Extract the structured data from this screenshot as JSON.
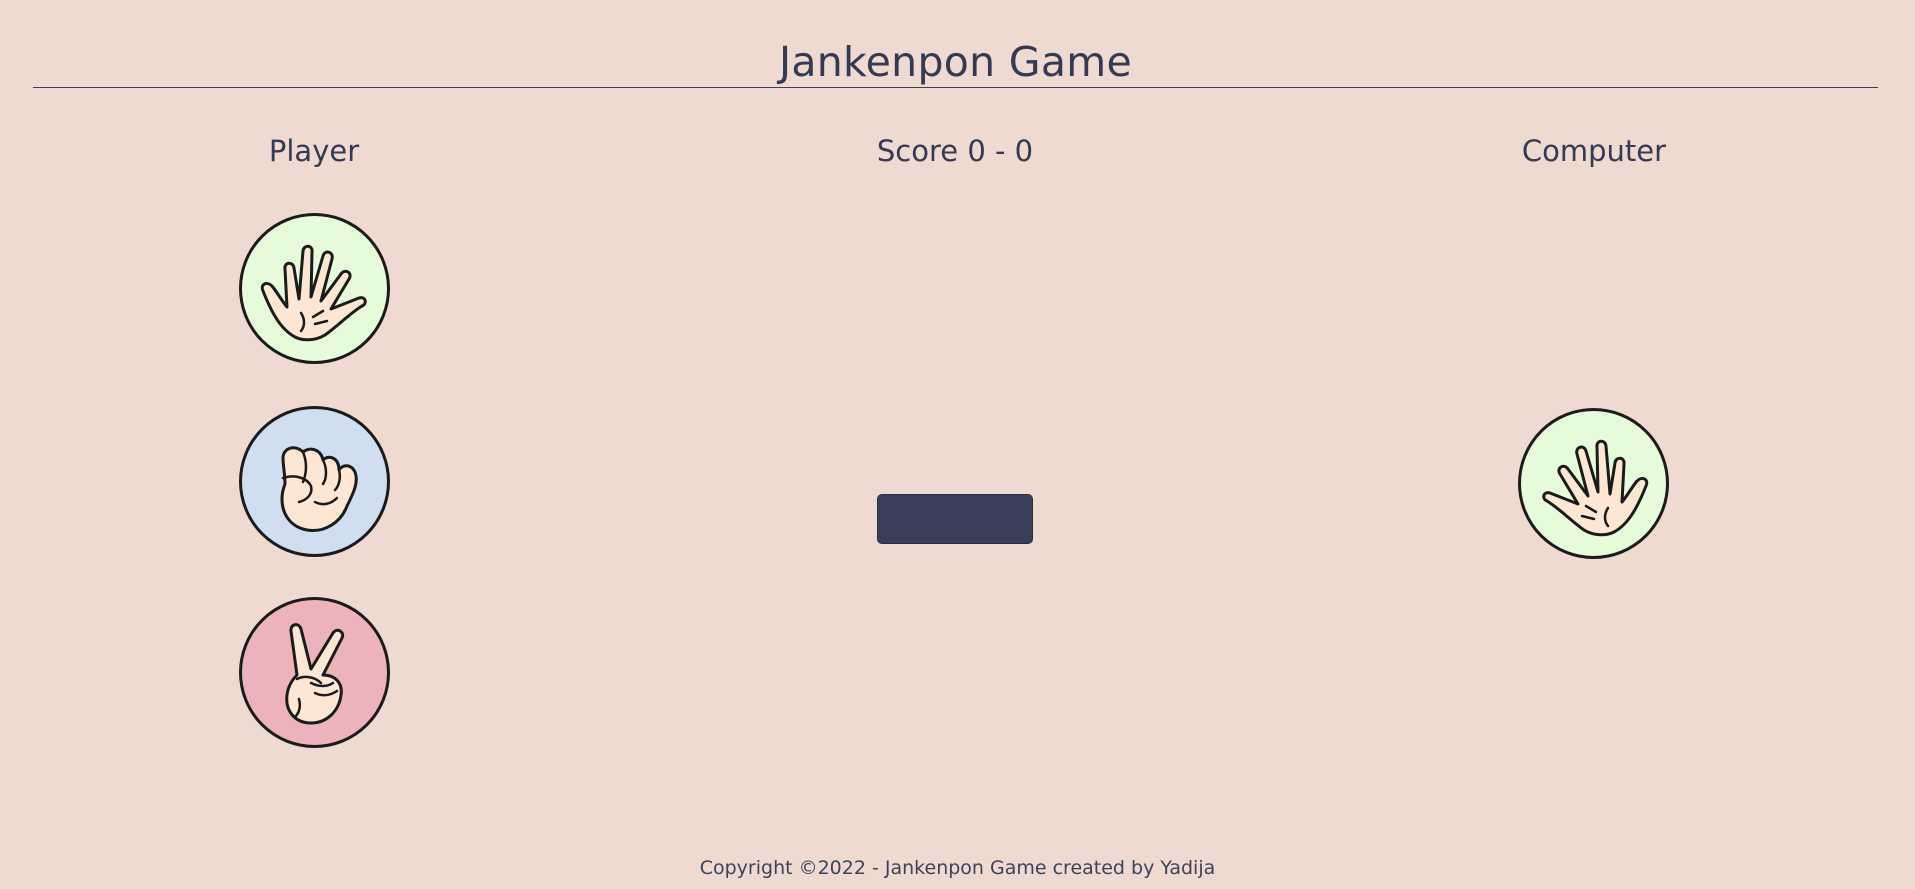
{
  "header": {
    "title": "Jankenpon Game"
  },
  "columns": {
    "player_label": "Player",
    "score_label": "Score 0 - 0",
    "computer_label": "Computer"
  },
  "player_choices": [
    {
      "name": "paper",
      "icon": "open-hand-icon",
      "color": "#e6fbdc"
    },
    {
      "name": "rock",
      "icon": "fist-icon",
      "color": "#cfdff0"
    },
    {
      "name": "scissors",
      "icon": "peace-hand-icon",
      "color": "#ecb4b8"
    }
  ],
  "computer": {
    "choice": "paper",
    "icon": "open-hand-icon",
    "color": "#e6fbdc"
  },
  "play_button": {
    "label": "",
    "color": "#3a3e59"
  },
  "footer": {
    "text": "Copyright ©2022 - Jankenpon Game created by Yadija"
  },
  "theme": {
    "background": "#efdad2",
    "text": "#343a52",
    "skin": "#fde6d4",
    "outline": "#1b1b1b"
  }
}
